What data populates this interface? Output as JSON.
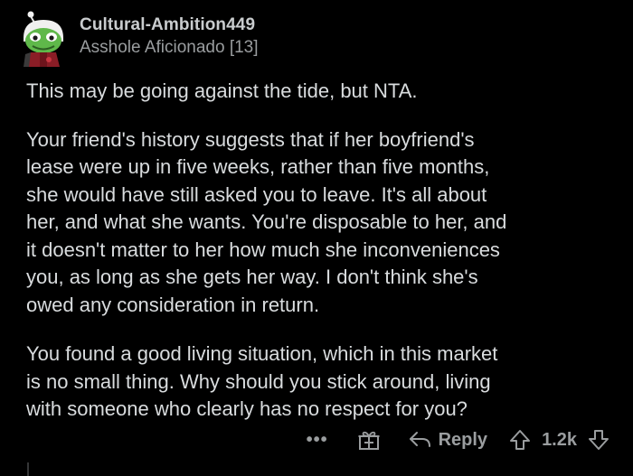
{
  "comment": {
    "username": "Cultural-Ambition449",
    "flair": "Asshole Aficionado [13]",
    "paragraphs": [
      "This may be going against the tide, but NTA.",
      "Your friend's history suggests that if her boyfriend's\nlease were up in five weeks, rather than five months,\nshe would have still asked you to leave.  It's all about\nher, and what she wants.  You're disposable to her, and\nit doesn't matter to her how much she inconveniences\nyou, as long as she gets her way.  I don't think she's\nowed any consideration in return.",
      "You found a good living situation, which in this market\nis no small thing.  Why should you stick around, living\nwith someone who clearly has no respect for you?"
    ]
  },
  "actions": {
    "more_label": "•••",
    "reply_label": "Reply",
    "score": "1.2k"
  },
  "icons": {
    "more": "more-options-icon",
    "award": "gift-award-icon",
    "reply": "reply-arrow-icon",
    "upvote": "upvote-arrow-icon",
    "downvote": "downvote-arrow-icon"
  },
  "colors": {
    "background": "#000000",
    "text": "#d9dcde",
    "muted": "#9a9d9f",
    "avatar_green": "#5fb84a",
    "avatar_red": "#a0202a"
  }
}
